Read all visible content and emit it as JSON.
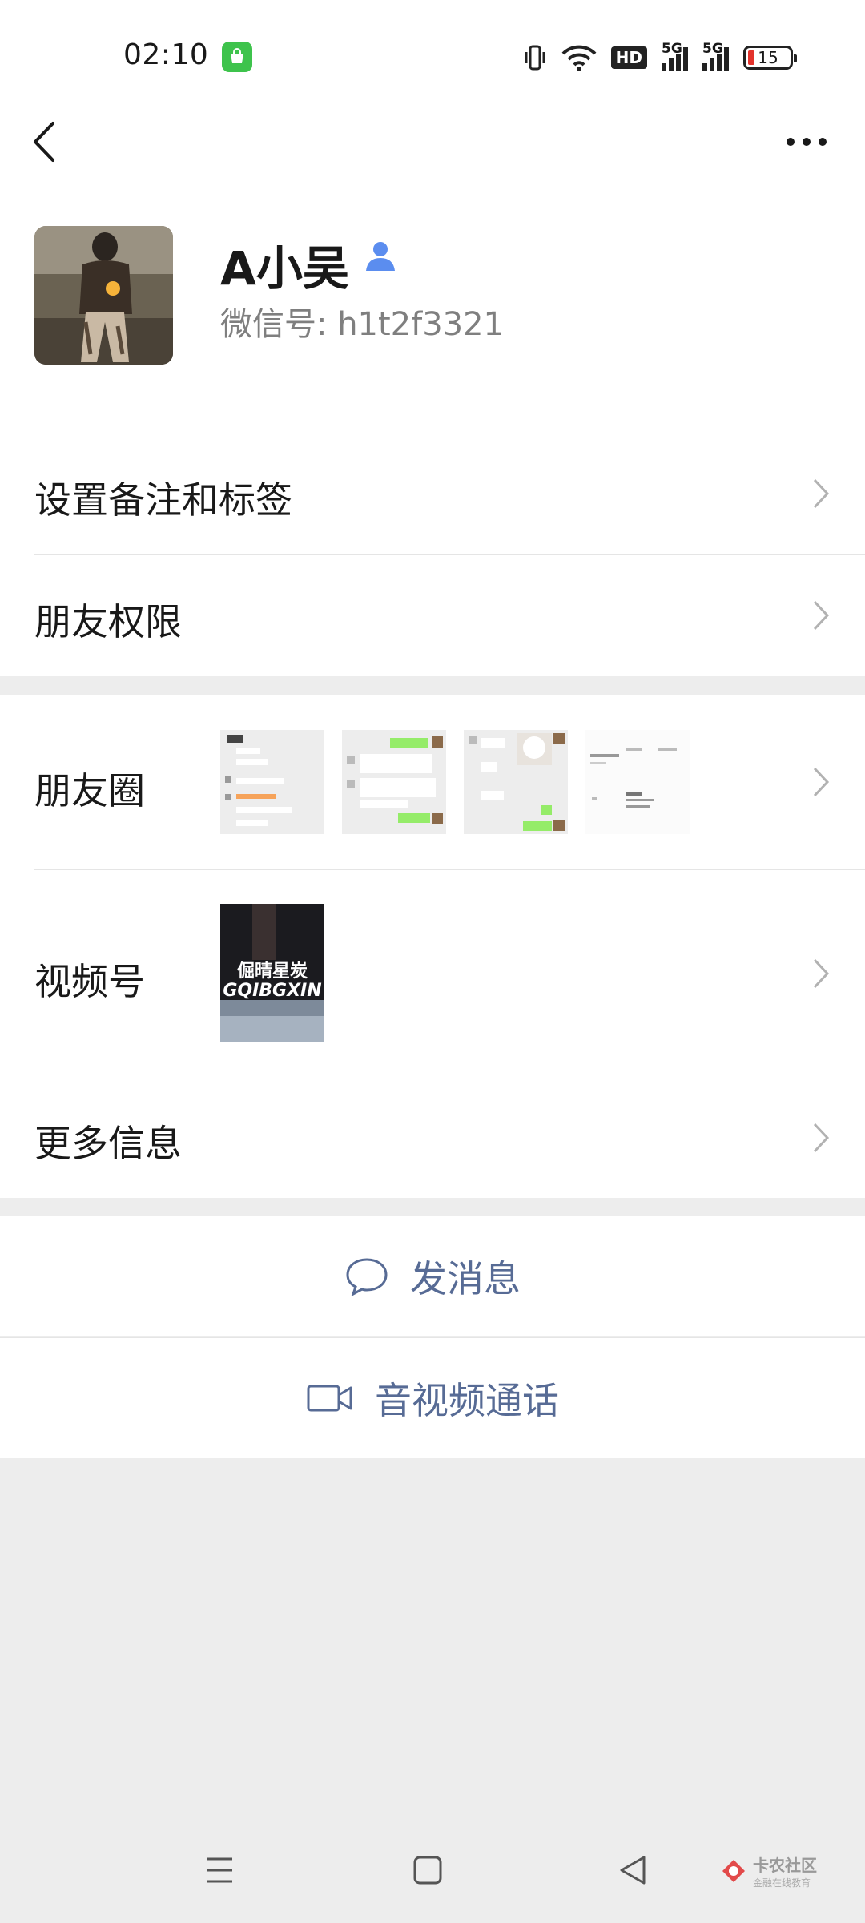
{
  "status_bar": {
    "time": "02:10",
    "battery": "15",
    "network_1": "5G",
    "network_2": "5G",
    "hd": "HD"
  },
  "profile": {
    "name": "A小吴",
    "wechat_id_label": "微信号: h1t2f3321"
  },
  "menu": {
    "remark_tags": "设置备注和标签",
    "friend_permissions": "朋友权限",
    "moments": "朋友圈",
    "channels": "视频号",
    "more_info": "更多信息"
  },
  "channels_thumb_text": "GQIBGXIN",
  "channels_thumb_cn": "倔晴星炭",
  "actions": {
    "send_message": "发消息",
    "av_call": "音视频通话"
  },
  "watermark": {
    "title": "卡农社区",
    "subtitle": "金融在线教育"
  },
  "colors": {
    "link_blue": "#576b95",
    "bg_gray": "#ededed",
    "battery_red": "#e3332c",
    "app_green": "#3ec34c"
  }
}
